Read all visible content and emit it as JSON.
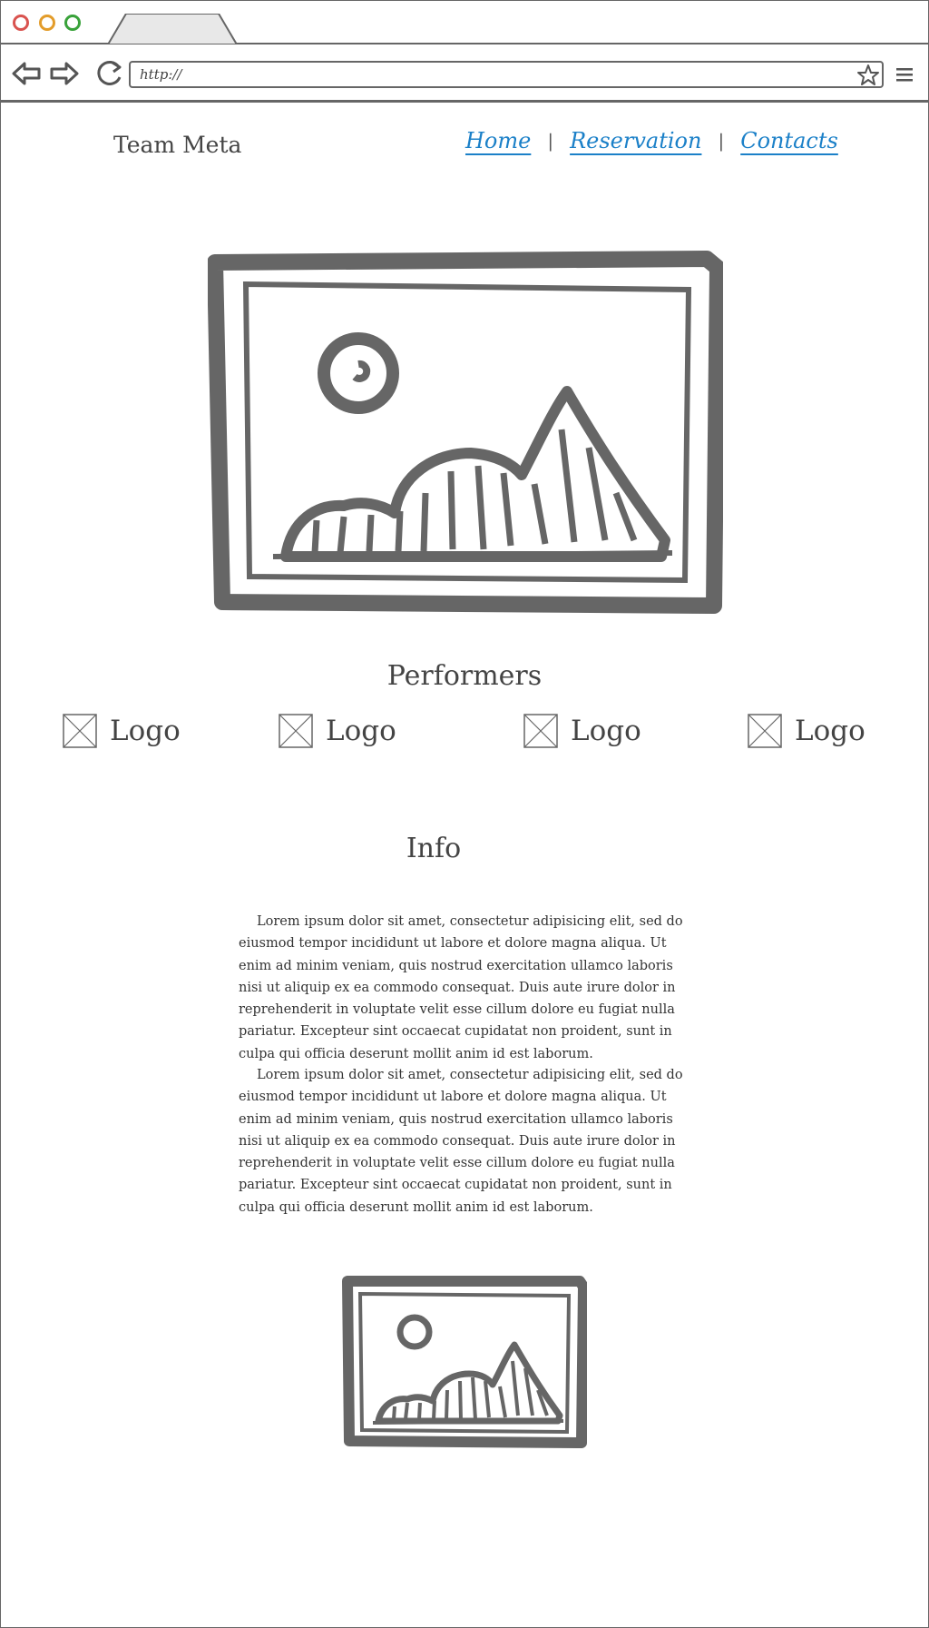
{
  "browser": {
    "url": "http://",
    "colors": {
      "close": "#d9534f",
      "minimize": "#e39c2a",
      "maximize": "#39a23a"
    }
  },
  "header": {
    "brand": "Team Meta",
    "nav": [
      {
        "label": "Home"
      },
      {
        "label": "Reservation"
      },
      {
        "label": "Contacts"
      }
    ],
    "separator": "|",
    "link_color": "#1b80c8"
  },
  "performers": {
    "heading": "Performers",
    "logos": [
      {
        "label": "Logo"
      },
      {
        "label": "Logo"
      },
      {
        "label": "Logo"
      },
      {
        "label": "Logo"
      }
    ]
  },
  "info": {
    "heading": "Info",
    "paragraphs": [
      "Lorem ipsum dolor sit amet, consectetur adipisicing elit, sed do eiusmod tempor incididunt ut labore et dolore magna aliqua. Ut enim ad minim veniam, quis nostrud exercitation ullamco laboris nisi ut aliquip ex ea commodo consequat. Duis aute irure dolor in reprehenderit in voluptate velit esse cillum dolore eu fugiat nulla pariatur. Excepteur sint occaecat cupidatat non proident, sunt in culpa qui officia deserunt mollit anim id est laborum.",
      "Lorem ipsum dolor sit amet, consectetur adipisicing elit, sed do eiusmod tempor incididunt ut labore et dolore magna aliqua. Ut enim ad minim veniam, quis nostrud exercitation ullamco laboris nisi ut aliquip ex ea commodo consequat. Duis aute irure dolor in reprehenderit in voluptate velit esse cillum dolore eu fugiat nulla pariatur. Excepteur sint occaecat cupidatat non proident, sunt in culpa qui officia deserunt mollit anim id est laborum."
    ]
  },
  "icons": [
    "back-arrow-icon",
    "forward-arrow-icon",
    "reload-icon",
    "bookmark-star-icon",
    "hamburger-menu-icon",
    "image-placeholder-icon",
    "logo-placeholder-icon"
  ]
}
